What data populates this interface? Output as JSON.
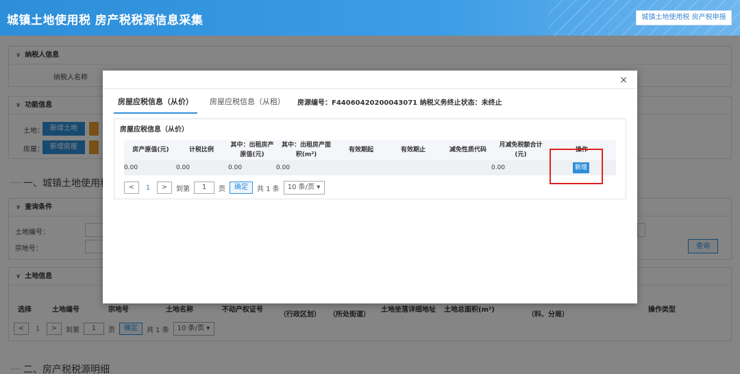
{
  "header": {
    "title": "城镇土地使用税 房产税税源信息采集",
    "right_button": "城镇土地使用税 房产税申报"
  },
  "background": {
    "taxpayer_panel_title": "纳税人信息",
    "taxpayer_name_label": "纳税人名称",
    "function_panel_title": "功能信息",
    "land_label": "土地：",
    "land_add_button": "新增土地",
    "house_label": "房屋：",
    "house_add_button": "新增房屋",
    "section1_title": "一、城镇土地使用税",
    "query_panel_title": "查询条件",
    "land_no_label": "土地编号：",
    "parcel_no_label": "宗地号：",
    "query_button": "查询",
    "land_info_panel_title": "土地信息",
    "land_columns": {
      "select": "选择",
      "land_no": "土地编号",
      "parcel_no": "宗地号",
      "land_name": "土地名称",
      "cert_no": "不动产权证号",
      "district": "（行政区划）",
      "street": "（所处街道）",
      "address": "土地坐落详细地址",
      "area": "土地总面积(m²)",
      "authority": "（科、分局）",
      "op_type": "操作类型"
    },
    "pager": {
      "page": "1",
      "goto_label": "到第",
      "goto_value": "1",
      "page_unit": "页",
      "confirm": "确定",
      "total": "共 1 条",
      "page_size": "10 条/页"
    },
    "section2_title": "二、房产税税源明细"
  },
  "modal": {
    "close_icon": "×",
    "tabs": [
      {
        "label": "房屋应税信息（从价）",
        "active": true
      },
      {
        "label": "房屋应税信息（从租）",
        "active": false
      }
    ],
    "house_info": "房源编号：F44060420200043071 纳税义务终止状态：未终止",
    "box_title": "房屋应税信息（从价）",
    "columns": {
      "original_value": "房产原值(元)",
      "tax_ratio": "计税比例",
      "rental_value_1": "其中：出租房产",
      "rental_value_2": "原值(元)",
      "rental_area_1": "其中：出租房产面",
      "rental_area_2": "积(m²)",
      "valid_from": "有效期起",
      "valid_to": "有效期止",
      "exempt_code": "减免性质代码",
      "monthly_exempt_1": "月减免税额合计",
      "monthly_exempt_2": "(元)",
      "operation": "操作"
    },
    "row": {
      "original_value": "0.00",
      "tax_ratio": "0.00",
      "rental_value": "0.00",
      "rental_area": "0.00",
      "valid_from": "",
      "valid_to": "",
      "exempt_code": "",
      "monthly_exempt": "0.00",
      "add_button": "新增"
    },
    "pager": {
      "page": "1",
      "goto_label": "到第",
      "goto_value": "1",
      "page_unit": "页",
      "confirm": "确定",
      "total": "共 1 条",
      "page_size": "10 条/页"
    },
    "highlight_color": "#e02020"
  }
}
